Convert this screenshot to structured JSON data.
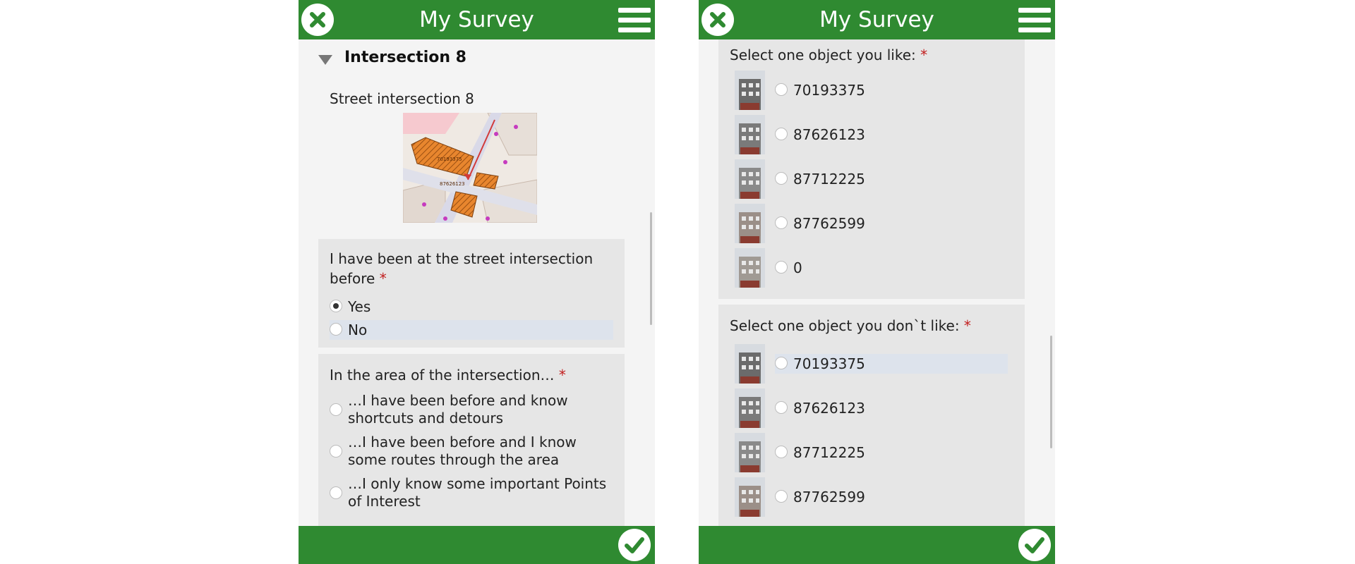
{
  "left_panel": {
    "title": "My Survey",
    "group": {
      "name": "Intersection 8",
      "image_caption": "Street intersection 8",
      "map_labels": [
        "70193375",
        "87626123"
      ]
    },
    "q1": {
      "label": "I have been at the street intersection before",
      "required_mark": "*",
      "options": [
        "Yes",
        "No"
      ],
      "selected": "Yes"
    },
    "q2": {
      "label": "In the area of the intersection…",
      "required_mark": "*",
      "options": [
        "…I have been before and know shortcuts and detours",
        "…I have been before and I know some routes through the area",
        "…I only know some important Points of Interest"
      ]
    }
  },
  "right_panel": {
    "title": "My Survey",
    "like": {
      "label": "Select one object you like:",
      "required_mark": "*",
      "options": [
        "70193375",
        "87626123",
        "87712225",
        "87762599",
        "0"
      ]
    },
    "dislike": {
      "label": "Select one object you don`t like:",
      "required_mark": "*",
      "options": [
        "70193375",
        "87626123",
        "87712225",
        "87762599"
      ]
    }
  },
  "icons": {
    "close": "close-icon",
    "menu": "menu-icon",
    "submit": "checkmark-icon",
    "collapse": "triangle-down-icon"
  },
  "colors": {
    "appbar": "#2f8a31",
    "card": "#e6e6e6",
    "required": "#c21e1e",
    "highlight": "#dde3ec"
  }
}
